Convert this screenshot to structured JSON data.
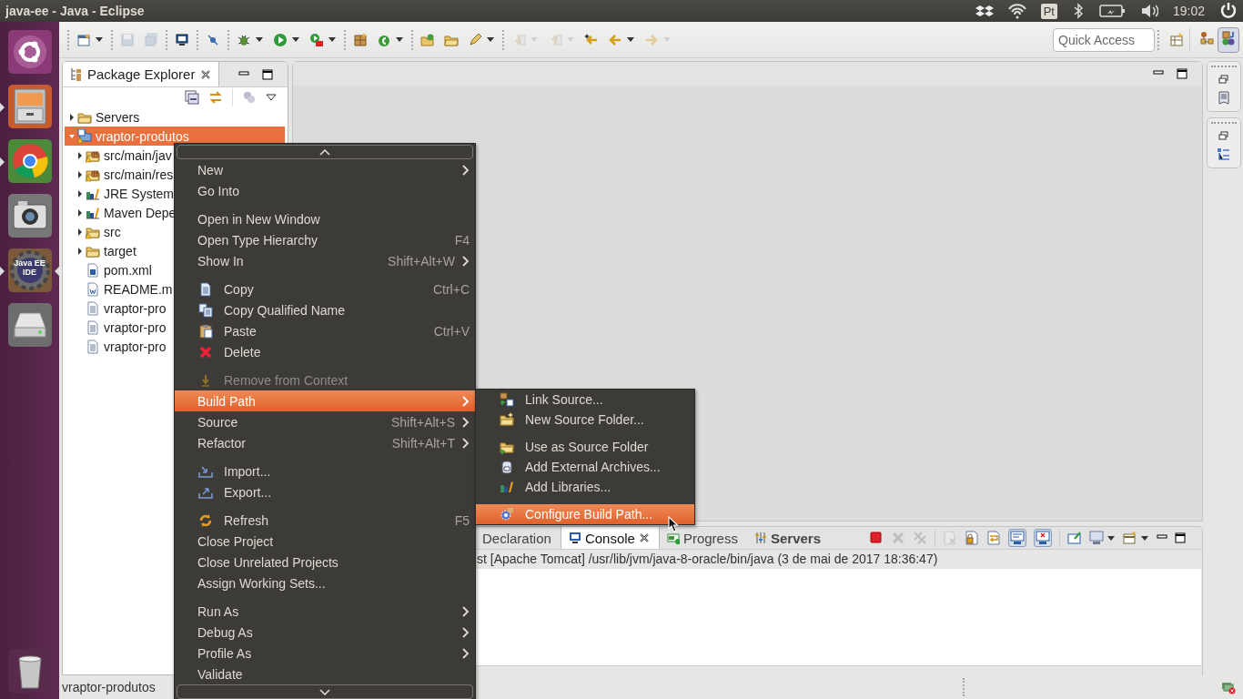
{
  "topbar": {
    "title": "java-ee - Java - Eclipse",
    "keyboard_layout": "Pt",
    "clock": "19:02"
  },
  "launcher": {
    "items": [
      {
        "running": false,
        "focused": false
      },
      {
        "running": true,
        "focused": false
      },
      {
        "running": true,
        "focused": false
      },
      {
        "running": false,
        "focused": false
      },
      {
        "running": true,
        "focused": true,
        "label": "Java EE IDE"
      },
      {
        "running": false,
        "focused": false
      },
      {
        "running": false,
        "focused": false
      }
    ]
  },
  "toolbar": {
    "buttons": [
      {
        "group_start": true,
        "disabled": false,
        "dropdown": true
      },
      {
        "group_start": true,
        "disabled": true,
        "dropdown": false
      },
      {
        "group_start": false,
        "disabled": true,
        "dropdown": false
      },
      {
        "group_start": true,
        "disabled": false,
        "dropdown": false
      },
      {
        "group_start": true,
        "disabled": false,
        "dropdown": false
      },
      {
        "group_start": true,
        "disabled": false,
        "dropdown": true
      },
      {
        "group_start": false,
        "disabled": false,
        "dropdown": true
      },
      {
        "group_start": false,
        "disabled": false,
        "dropdown": true
      },
      {
        "group_start": true,
        "disabled": false,
        "dropdown": false
      },
      {
        "group_start": false,
        "disabled": false,
        "dropdown": true
      },
      {
        "group_start": true,
        "disabled": false,
        "dropdown": false
      },
      {
        "group_start": false,
        "disabled": false,
        "dropdown": false
      },
      {
        "group_start": false,
        "disabled": false,
        "dropdown": true
      },
      {
        "group_start": true,
        "disabled": true,
        "dropdown": true
      },
      {
        "group_start": false,
        "disabled": true,
        "dropdown": true
      },
      {
        "group_start": false,
        "disabled": false,
        "dropdown": false
      },
      {
        "group_start": false,
        "disabled": false,
        "dropdown": true
      },
      {
        "group_start": false,
        "disabled": true,
        "dropdown": true
      }
    ],
    "quick_access": {
      "placeholder": "Quick Access"
    },
    "perspectives": [
      {
        "selected": false
      },
      {
        "selected": true
      }
    ]
  },
  "explorer": {
    "title": "Package Explorer",
    "tree": [
      {
        "label": "Servers",
        "kind": "folder",
        "expanded": false,
        "selected": false
      },
      {
        "label": "vraptor-produtos",
        "kind": "project",
        "expanded": true,
        "selected": true,
        "children": [
          {
            "label": "src/main/jav",
            "kind": "source-folder",
            "expanded": false,
            "selected": false
          },
          {
            "label": "src/main/res",
            "kind": "source-folder",
            "expanded": false,
            "selected": false
          },
          {
            "label": "JRE System",
            "kind": "library",
            "expanded": false,
            "selected": false
          },
          {
            "label": "Maven Depe",
            "kind": "library",
            "expanded": false,
            "selected": false
          },
          {
            "label": "src",
            "kind": "warn-folder",
            "expanded": false,
            "selected": false
          },
          {
            "label": "target",
            "kind": "folder",
            "expanded": false,
            "selected": false
          },
          {
            "label": "pom.xml",
            "kind": "maven-file",
            "selected": false
          },
          {
            "label": "README.m",
            "kind": "word-file",
            "selected": false
          },
          {
            "label": "vraptor-pro",
            "kind": "file",
            "selected": false
          },
          {
            "label": "vraptor-pro",
            "kind": "file",
            "selected": false
          },
          {
            "label": "vraptor-pro",
            "kind": "file",
            "selected": false
          }
        ]
      }
    ]
  },
  "console": {
    "tabs": [
      {
        "label": "Declaration",
        "selected": false,
        "bold": false
      },
      {
        "label": "Console",
        "selected": true,
        "bold": false
      },
      {
        "label": "Progress",
        "selected": false,
        "bold": false
      },
      {
        "label": "Servers",
        "selected": false,
        "bold": true
      }
    ],
    "toolbar": [
      {
        "disabled": false,
        "pressed": false,
        "dropdown": false
      },
      {
        "disabled": true,
        "pressed": false,
        "dropdown": false
      },
      {
        "disabled": true,
        "pressed": false,
        "dropdown": false
      },
      {
        "disabled": true,
        "pressed": false,
        "dropdown": false
      },
      {
        "disabled": false,
        "pressed": false,
        "dropdown": false
      },
      {
        "disabled": false,
        "pressed": false,
        "dropdown": false
      },
      {
        "disabled": false,
        "pressed": true,
        "dropdown": false
      },
      {
        "disabled": false,
        "pressed": true,
        "dropdown": false
      },
      {
        "disabled": false,
        "pressed": false,
        "dropdown": false
      },
      {
        "disabled": false,
        "pressed": false,
        "dropdown": true
      },
      {
        "disabled": false,
        "pressed": false,
        "dropdown": true
      }
    ],
    "header": "st [Apache Tomcat] /usr/lib/jvm/java-8-oracle/bin/java (3 de mai de 2017 18:36:47)"
  },
  "status_bar": {
    "text": "vraptor-produtos"
  },
  "context_menu": {
    "items": [
      {
        "kind": "plain",
        "label": "New",
        "submenu": true,
        "selected": false,
        "disabled": false
      },
      {
        "kind": "plain",
        "label": "Go Into",
        "submenu": false,
        "selected": false,
        "disabled": false
      },
      {
        "kind": "separator"
      },
      {
        "kind": "plain",
        "label": "Open in New Window",
        "submenu": false,
        "selected": false,
        "disabled": false
      },
      {
        "kind": "plain",
        "label": "Open Type Hierarchy",
        "shortcut": "F4",
        "submenu": false,
        "selected": false,
        "disabled": false
      },
      {
        "kind": "plain",
        "label": "Show In",
        "shortcut": "Shift+Alt+W",
        "submenu": true,
        "selected": false,
        "disabled": false
      },
      {
        "kind": "separator"
      },
      {
        "kind": "icon",
        "label": "Copy",
        "shortcut": "Ctrl+C",
        "submenu": false,
        "selected": false,
        "disabled": false
      },
      {
        "kind": "icon",
        "label": "Copy Qualified Name",
        "submenu": false,
        "selected": false,
        "disabled": false
      },
      {
        "kind": "icon",
        "label": "Paste",
        "shortcut": "Ctrl+V",
        "submenu": false,
        "selected": false,
        "disabled": false
      },
      {
        "kind": "icon",
        "label": "Delete",
        "submenu": false,
        "selected": false,
        "disabled": false
      },
      {
        "kind": "separator"
      },
      {
        "kind": "icon",
        "label": "Remove from Context",
        "submenu": false,
        "selected": false,
        "disabled": true
      },
      {
        "kind": "plain",
        "label": "Build Path",
        "submenu": true,
        "selected": true,
        "disabled": false
      },
      {
        "kind": "plain",
        "label": "Source",
        "shortcut": "Shift+Alt+S",
        "submenu": true,
        "selected": false,
        "disabled": false
      },
      {
        "kind": "plain",
        "label": "Refactor",
        "shortcut": "Shift+Alt+T",
        "submenu": true,
        "selected": false,
        "disabled": false
      },
      {
        "kind": "separator"
      },
      {
        "kind": "icon",
        "label": "Import...",
        "submenu": false,
        "selected": false,
        "disabled": false
      },
      {
        "kind": "icon",
        "label": "Export...",
        "submenu": false,
        "selected": false,
        "disabled": false
      },
      {
        "kind": "separator"
      },
      {
        "kind": "icon",
        "label": "Refresh",
        "shortcut": "F5",
        "submenu": false,
        "selected": false,
        "disabled": false
      },
      {
        "kind": "plain",
        "label": "Close Project",
        "submenu": false,
        "selected": false,
        "disabled": false
      },
      {
        "kind": "plain",
        "label": "Close Unrelated Projects",
        "submenu": false,
        "selected": false,
        "disabled": false
      },
      {
        "kind": "plain",
        "label": "Assign Working Sets...",
        "submenu": false,
        "selected": false,
        "disabled": false
      },
      {
        "kind": "separator"
      },
      {
        "kind": "plain",
        "label": "Run As",
        "submenu": true,
        "selected": false,
        "disabled": false
      },
      {
        "kind": "plain",
        "label": "Debug As",
        "submenu": true,
        "selected": false,
        "disabled": false
      },
      {
        "kind": "plain",
        "label": "Profile As",
        "submenu": true,
        "selected": false,
        "disabled": false
      },
      {
        "kind": "plain",
        "label": "Validate",
        "submenu": false,
        "selected": false,
        "disabled": false
      }
    ]
  },
  "build_path_menu": {
    "items": [
      {
        "kind": "icon",
        "label": "Link Source...",
        "selected": false
      },
      {
        "kind": "icon",
        "label": "New Source Folder...",
        "selected": false
      },
      {
        "kind": "separator"
      },
      {
        "kind": "icon",
        "label": "Use as Source Folder",
        "selected": false
      },
      {
        "kind": "icon",
        "label": "Add External Archives...",
        "selected": false
      },
      {
        "kind": "icon",
        "label": "Add Libraries...",
        "selected": false
      },
      {
        "kind": "separator"
      },
      {
        "kind": "icon",
        "label": "Configure Build Path...",
        "selected": true
      }
    ]
  }
}
